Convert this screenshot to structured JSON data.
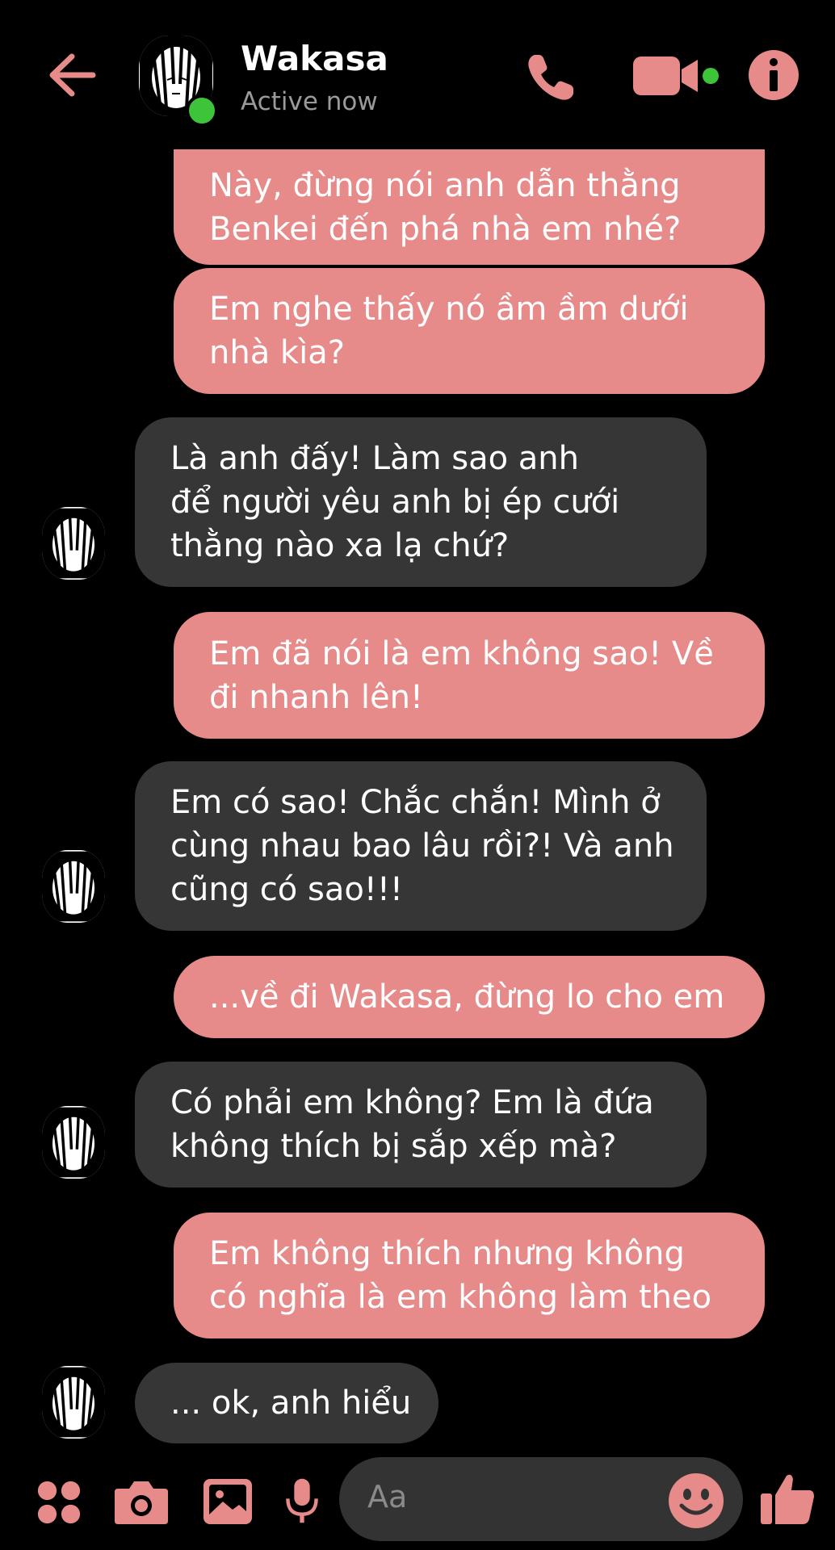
{
  "header": {
    "contact_name": "Wakasa",
    "status": "Active now",
    "icons": {
      "back": "back-arrow-icon",
      "call": "phone-icon",
      "video": "video-camera-icon",
      "info": "info-icon"
    }
  },
  "messages": [
    {
      "sender": "me",
      "lines": [
        "Này, đừng nói anh dẫn thằng",
        "Benkei đến phá nhà em nhé?"
      ]
    },
    {
      "sender": "me",
      "lines": [
        "Em nghe thấy nó ầm ầm dưới",
        "nhà kìa?"
      ]
    },
    {
      "sender": "them",
      "lines": [
        "Là anh đấy! Làm sao anh",
        "để người yêu anh bị ép cưới",
        "thằng nào xa lạ chứ?"
      ]
    },
    {
      "sender": "me",
      "lines": [
        "Em đã nói là em không sao! Về",
        "đi nhanh lên!"
      ]
    },
    {
      "sender": "them",
      "lines": [
        "Em có sao! Chắc chắn! Mình ở",
        "cùng nhau bao lâu rồi?! Và anh",
        "cũng có sao!!!"
      ]
    },
    {
      "sender": "me",
      "lines": [
        "...về đi Wakasa, đừng lo cho em"
      ]
    },
    {
      "sender": "them",
      "lines": [
        "Có phải em không? Em là đứa",
        "không thích bị sắp xếp mà?"
      ]
    },
    {
      "sender": "me",
      "lines": [
        "Em không thích nhưng không",
        "có nghĩa là em không làm theo"
      ]
    },
    {
      "sender": "them",
      "lines": [
        "... ok, anh hiểu"
      ]
    }
  ],
  "composer": {
    "placeholder": "Aa",
    "icons": [
      "apps-icon",
      "camera-icon",
      "image-icon",
      "microphone-icon",
      "emoji-icon",
      "thumbs-up-icon"
    ]
  },
  "colors": {
    "accent": "#e78a8a",
    "background": "#000000",
    "incoming_bubble": "#363636",
    "online": "#3ec43b"
  }
}
